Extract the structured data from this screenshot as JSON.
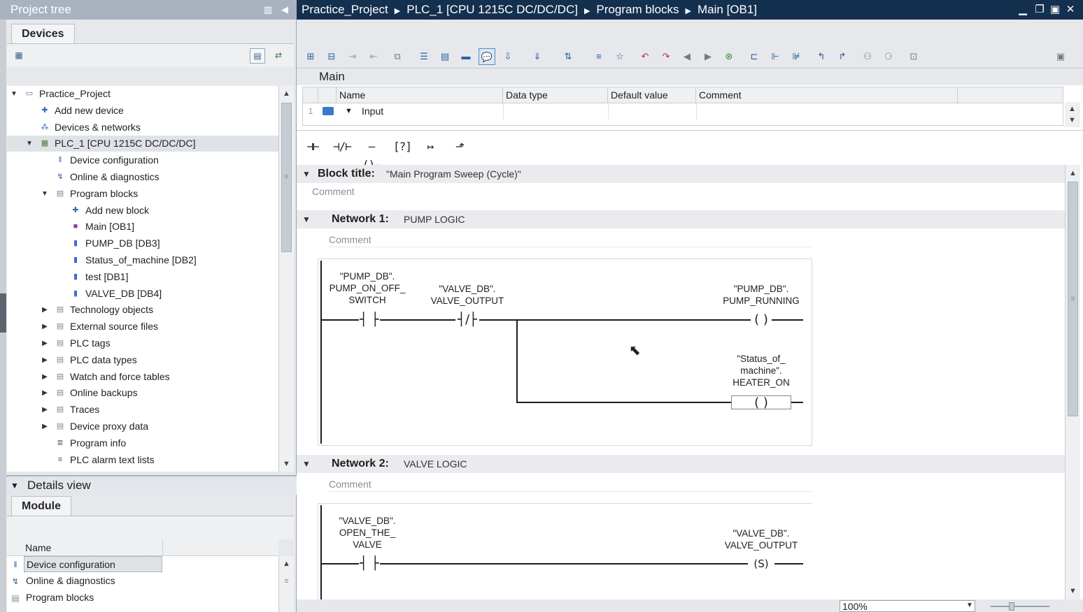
{
  "project_tree": {
    "title": "Project tree",
    "tab": "Devices",
    "items": [
      {
        "label": "Practice_Project",
        "arrow": "▼",
        "depth": 0,
        "icon": "document-icon",
        "glyph": "▭",
        "color": "#5a6e84"
      },
      {
        "label": "Add new device",
        "arrow": "",
        "depth": 1,
        "icon": "add-device-icon",
        "glyph": "✚",
        "color": "#2f6db5"
      },
      {
        "label": "Devices & networks",
        "arrow": "",
        "depth": 1,
        "icon": "network-icon",
        "glyph": "⁂",
        "color": "#3a68a6"
      },
      {
        "label": "PLC_1 [CPU 1215C DC/DC/DC]",
        "arrow": "▼",
        "depth": 1,
        "icon": "plc-icon",
        "glyph": "▦",
        "color": "#4f7a3a"
      },
      {
        "label": "Device configuration",
        "arrow": "",
        "depth": 2,
        "icon": "device-config-icon",
        "glyph": "‖",
        "color": "#2f5fa0"
      },
      {
        "label": "Online & diagnostics",
        "arrow": "",
        "depth": 2,
        "icon": "diagnostics-icon",
        "glyph": "↯",
        "color": "#2f5fa0"
      },
      {
        "label": "Program blocks",
        "arrow": "▼",
        "depth": 2,
        "icon": "folder-icon",
        "glyph": "▤",
        "color": "#7b8a99"
      },
      {
        "label": "Add new block",
        "arrow": "",
        "depth": 3,
        "icon": "add-block-icon",
        "glyph": "✚",
        "color": "#2f6db5"
      },
      {
        "label": "Main [OB1]",
        "arrow": "",
        "depth": 3,
        "icon": "ob-block-icon",
        "glyph": "■",
        "color": "#8e3fb6"
      },
      {
        "label": "PUMP_DB [DB3]",
        "arrow": "",
        "depth": 3,
        "icon": "db-block-icon",
        "glyph": "▮",
        "color": "#3b6fd6"
      },
      {
        "label": "Status_of_machine [DB2]",
        "arrow": "",
        "depth": 3,
        "icon": "db-block-icon",
        "glyph": "▮",
        "color": "#3b6fd6"
      },
      {
        "label": "test [DB1]",
        "arrow": "",
        "depth": 3,
        "icon": "db-block-icon",
        "glyph": "▮",
        "color": "#3b6fd6"
      },
      {
        "label": "VALVE_DB [DB4]",
        "arrow": "",
        "depth": 3,
        "icon": "db-block-icon",
        "glyph": "▮",
        "color": "#3b6fd6"
      },
      {
        "label": "Technology objects",
        "arrow": "▶",
        "depth": 2,
        "icon": "folder-icon",
        "glyph": "▤",
        "color": "#7b8a99"
      },
      {
        "label": "External source files",
        "arrow": "▶",
        "depth": 2,
        "icon": "folder-icon",
        "glyph": "▤",
        "color": "#7b8a99"
      },
      {
        "label": "PLC tags",
        "arrow": "▶",
        "depth": 2,
        "icon": "folder-icon",
        "glyph": "▤",
        "color": "#7b8a99"
      },
      {
        "label": "PLC data types",
        "arrow": "▶",
        "depth": 2,
        "icon": "folder-icon",
        "glyph": "▤",
        "color": "#7b8a99"
      },
      {
        "label": "Watch and force tables",
        "arrow": "▶",
        "depth": 2,
        "icon": "folder-icon",
        "glyph": "▤",
        "color": "#7b8a99"
      },
      {
        "label": "Online backups",
        "arrow": "▶",
        "depth": 2,
        "icon": "folder-icon",
        "glyph": "▤",
        "color": "#7b8a99"
      },
      {
        "label": "Traces",
        "arrow": "▶",
        "depth": 2,
        "icon": "folder-icon",
        "glyph": "▤",
        "color": "#7b8a99"
      },
      {
        "label": "Device proxy data",
        "arrow": "▶",
        "depth": 2,
        "icon": "folder-icon",
        "glyph": "▤",
        "color": "#7b8a99"
      },
      {
        "label": "Program info",
        "arrow": "",
        "depth": 2,
        "icon": "program-info-icon",
        "glyph": "≣",
        "color": "#445566"
      },
      {
        "label": "PLC alarm text lists",
        "arrow": "",
        "depth": 2,
        "icon": "alarm-list-icon",
        "glyph": "≡",
        "color": "#445566"
      }
    ]
  },
  "details_view": {
    "title": "Details view",
    "tab": "Module",
    "column": "Name",
    "rows": [
      {
        "label": "Device configuration",
        "icon": "device-config-icon",
        "glyph": "‖",
        "color": "#2f5fa0"
      },
      {
        "label": "Online & diagnostics",
        "icon": "diagnostics-icon",
        "glyph": "↯",
        "color": "#2f5fa0"
      },
      {
        "label": "Program blocks",
        "icon": "folder-icon",
        "glyph": "▤",
        "color": "#7b8a99"
      }
    ]
  },
  "breadcrumb": [
    "Practice_Project",
    "PLC_1 [CPU 1215C DC/DC/DC]",
    "Program blocks",
    "Main [OB1]"
  ],
  "interface": {
    "title": "Main",
    "columns": [
      "Name",
      "Data type",
      "Default value",
      "Comment"
    ],
    "row": {
      "index": "1",
      "name": "Input"
    }
  },
  "ladder_toolbar": [
    {
      "name": "no-contact",
      "glyph": "⊣⊢"
    },
    {
      "name": "nc-contact",
      "glyph": "⊣/⊢"
    },
    {
      "name": "coil",
      "glyph": "–()–"
    },
    {
      "name": "empty-box",
      "glyph": "[?]"
    },
    {
      "name": "open-branch",
      "glyph": "↦"
    },
    {
      "name": "close-branch",
      "glyph": "⬏"
    }
  ],
  "block": {
    "title_label": "Block title:",
    "title_value": "\"Main Program Sweep (Cycle)\"",
    "comment": "Comment"
  },
  "networks": [
    {
      "label": "Network 1:",
      "title": "PUMP LOGIC",
      "comment": "Comment",
      "contact1": "\"PUMP_DB\".\nPUMP_ON_OFF_\nSWITCH",
      "contact2": "\"VALVE_DB\".\nVALVE_OUTPUT",
      "coil1": "\"PUMP_DB\".\nPUMP_RUNNING",
      "coil2": "\"Status_of_\nmachine\".\nHEATER_ON"
    },
    {
      "label": "Network 2:",
      "title": "VALVE LOGIC",
      "comment": "Comment",
      "contact1": "\"VALVE_DB\".\nOPEN_THE_\nVALVE",
      "coil1": "\"VALVE_DB\".\nVALVE_OUTPUT",
      "coil1_type": "S"
    }
  ],
  "zoom": "100%"
}
